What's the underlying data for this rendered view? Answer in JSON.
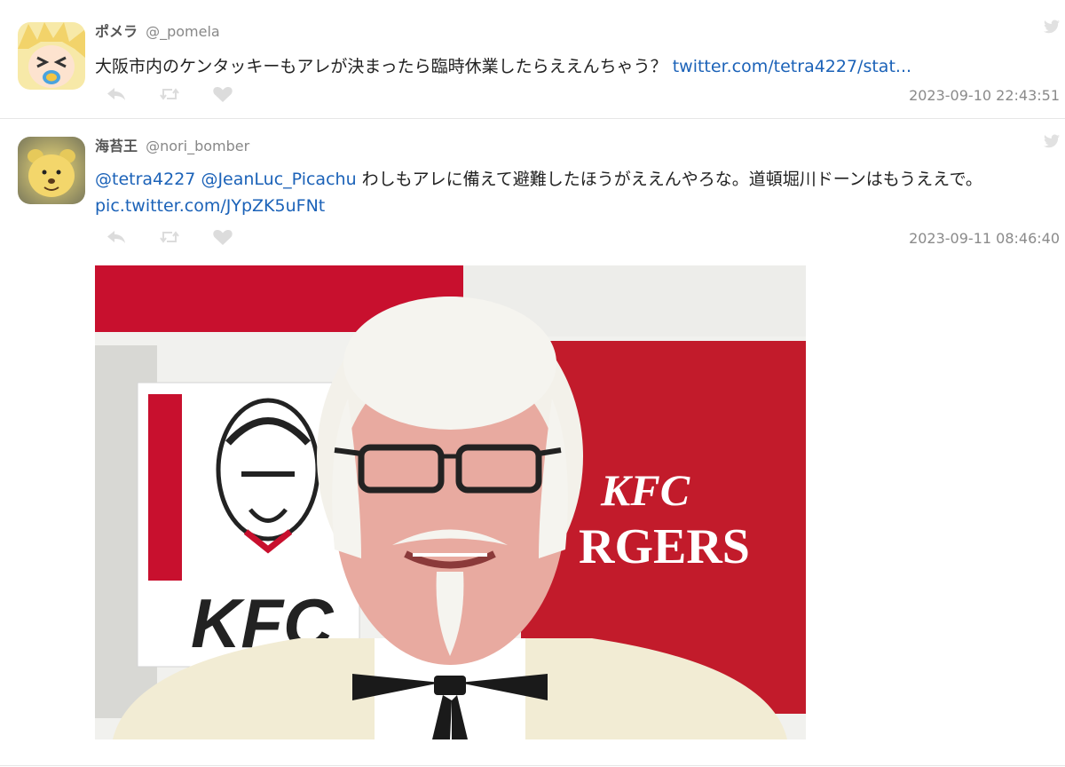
{
  "tweets": [
    {
      "display_name": "ポメラ",
      "screen_name": "@_pomela",
      "text": "大阪市内のケンタッキーもアレが決まったら臨時休業したらええんちゃう？ ",
      "link": "twitter.com/tetra4227/stat...",
      "timestamp": "2023-09-10 22:43:51",
      "avatar_icon": "anime-character-avatar"
    },
    {
      "display_name": "海苔王",
      "screen_name": "@nori_bomber",
      "mention1": "@tetra4227",
      "mention2": "@JeanLuc_Picachu",
      "text": " わしもアレに備えて避難したほうがええんやろな。道頓堀川ドーンはもうええで。 ",
      "link": "pic.twitter.com/JYpZK5uFNt",
      "timestamp": "2023-09-11 08:46:40",
      "avatar_icon": "bear-avatar",
      "media_text": {
        "logo_left": "KFC",
        "logo_right_1": "KFC",
        "logo_right_2": "RGERS"
      }
    }
  ],
  "colors": {
    "link": "#1b62b8",
    "kfc_red": "#c8102e",
    "icon_gray": "#d9d9d9"
  }
}
